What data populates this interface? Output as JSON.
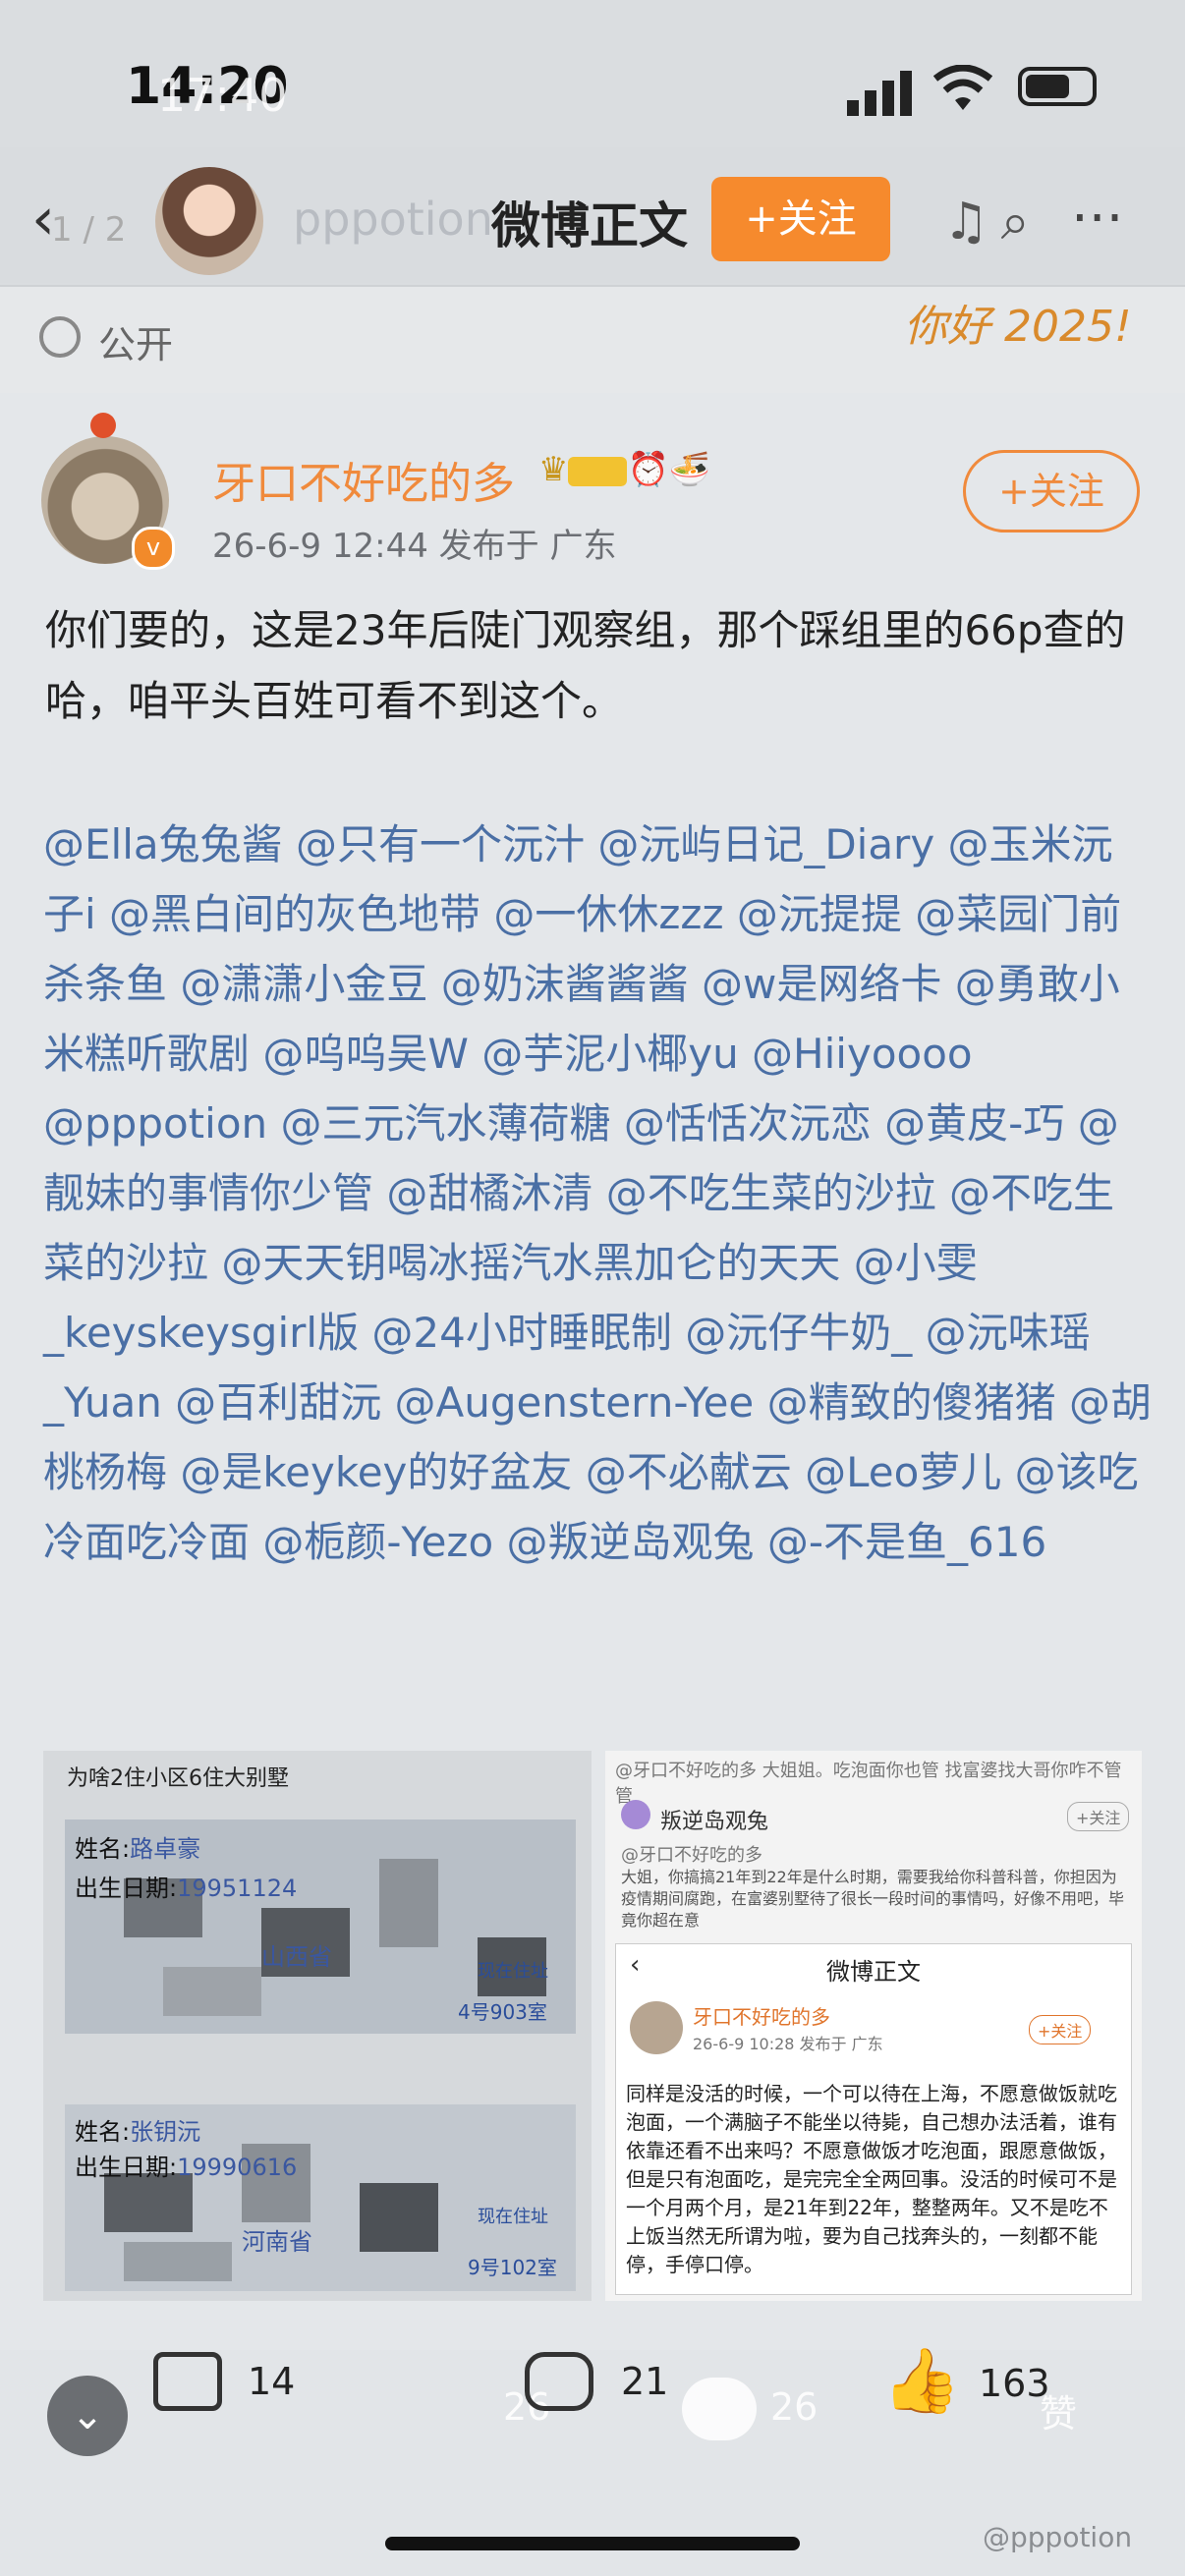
{
  "status": {
    "time": "14:20",
    "time_overlay": "17:40"
  },
  "header": {
    "pager": "1 / 2",
    "username": "pppotion",
    "title": "微博正文",
    "follow_label": "+关注"
  },
  "visibility": {
    "label": "公开",
    "sticker": "你好 2025!"
  },
  "post": {
    "author": "牙口不好吃的多",
    "meta": "26-6-9 12:44  发布于 广东",
    "follow_label": "+关注",
    "text": "你们要的，这是23年后陡门观察组，那个踩组里的66p查的哈，咱平头百姓可看不到这个。",
    "mentions": "@Ella兔兔酱 @只有一个沅汁 @沅屿日记_Diary @玉米沅子i @黑白间的灰色地带 @一休休zzz @沅提提 @菜园门前杀条鱼 @潇潇小金豆 @奶沫酱酱酱 @w是网络卡 @勇敢小米糕听歌剧 @呜呜吴W @芋泥小椰yu @Hiiyoooo @pppotion @三元汽水薄荷糖 @恬恬次沅恋 @黄皮-巧 @靓妹的事情你少管 @甜橘沐清 @不吃生菜的沙拉 @不吃生菜的沙拉 @天天钥喝冰摇汽水黑加仑的天天 @小雯_keyskeysgirl版 @24小时睡眠制 @沅仔牛奶_ @沅味瑶_Yuan @百利甜沅 @Augenstern-Yee @精致的傻猪猪 @胡桃杨梅 @是keykey的好盆友 @不必献云 @Leo萝儿 @该吃冷面吃冷面 @栀颜-Yezo @叛逆岛观兔 @-不是鱼_616"
  },
  "image1": {
    "caption": "为啥2住小区6住大别墅",
    "card1": {
      "name_label": "姓名:",
      "name_value": "路卓豪",
      "dob_label": "出生日期:",
      "dob_value": "19951124",
      "province": "山西省",
      "address_label": "现在住址",
      "room": "4号903室"
    },
    "card2": {
      "name_label": "姓名:",
      "name_value": "张钥沅",
      "dob_label": "出生日期:",
      "dob_value": "19990616",
      "province": "河南省",
      "address_label": "现在住址",
      "room": "9号102室"
    }
  },
  "image2": {
    "top_line": "@牙口不好吃的多 大姐姐。吃泡面你也管 找富婆找大哥你咋不管管",
    "commenter": "叛逆岛观兔",
    "comment_follow": "+关注",
    "reply_to": "@牙口不好吃的多",
    "reply_text": "大姐，你搞搞21年到22年是什么时期，需要我给你科普科普，你担因为疫情期间腐跑，在富婆别墅待了很长一段时间的事情吗，好像不用吧，毕竟你超在意",
    "inner_title": "微博正文",
    "inner_author": "牙口不好吃的多",
    "inner_meta": "26-6-9 10:28  发布于 广东",
    "inner_follow": "+关注",
    "inner_text": "同样是没活的时候，一个可以待在上海，不愿意做饭就吃泡面，一个满脑子不能坐以待毙，自己想办法活着，谁有依靠还看不出来吗？不愿意做饭才吃泡面，跟愿意做饭，但是只有泡面吃，是完完全全两回事。没活的时候可不是一个月两个月，是21年到22年，整整两年。又不是吃不上饭当然无所谓为啦，要为自己找奔头的，一刻都不能停，手停口停。"
  },
  "bottom": {
    "share_count": "14",
    "comment_count": "21",
    "like_count": "163",
    "ghost_share": "26",
    "ghost_comment": "26",
    "ghost_like_label": "赞",
    "watermark": "@pppotion"
  }
}
